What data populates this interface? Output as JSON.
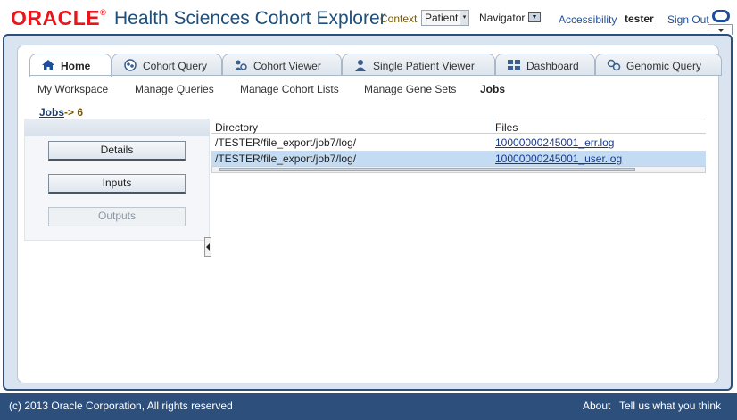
{
  "header": {
    "logo": "ORACLE",
    "app_title": "Health Sciences Cohort Explorer",
    "context_label": "Context",
    "context_value": "Patient",
    "navigator_label": "Navigator",
    "accessibility": "Accessibility",
    "user": "tester",
    "sign_out": "Sign Out"
  },
  "tabs": [
    {
      "label": "Home",
      "icon": "home-icon"
    },
    {
      "label": "Cohort Query",
      "icon": "cohort-query-icon"
    },
    {
      "label": "Cohort Viewer",
      "icon": "cohort-viewer-icon"
    },
    {
      "label": "Single Patient Viewer",
      "icon": "patient-icon"
    },
    {
      "label": "Dashboard",
      "icon": "dashboard-icon"
    },
    {
      "label": "Genomic Query",
      "icon": "genomic-query-icon"
    }
  ],
  "subnav": [
    "My Workspace",
    "Manage Queries",
    "Manage Cohort Lists",
    "Manage Gene Sets",
    "Jobs"
  ],
  "breadcrumb": {
    "link": "Jobs",
    "rest": "-> 6"
  },
  "left_panel": {
    "details": "Details",
    "inputs": "Inputs",
    "outputs": "Outputs"
  },
  "table": {
    "headers": [
      "Directory",
      "Files"
    ],
    "rows": [
      {
        "directory": "/TESTER/file_export/job7/log/",
        "file": "10000000245001_err.log"
      },
      {
        "directory": "/TESTER/file_export/job7/log/",
        "file": "10000000245001_user.log"
      }
    ]
  },
  "footer": {
    "copyright": "(c) 2013 Oracle Corporation, All rights reserved",
    "about": "About",
    "feedback": "Tell us what you think"
  },
  "colors": {
    "brand_red": "#e8161b",
    "frame_blue": "#2d4f7c",
    "link_blue": "#1f4f9a",
    "selected_row": "#c3dcf3"
  }
}
